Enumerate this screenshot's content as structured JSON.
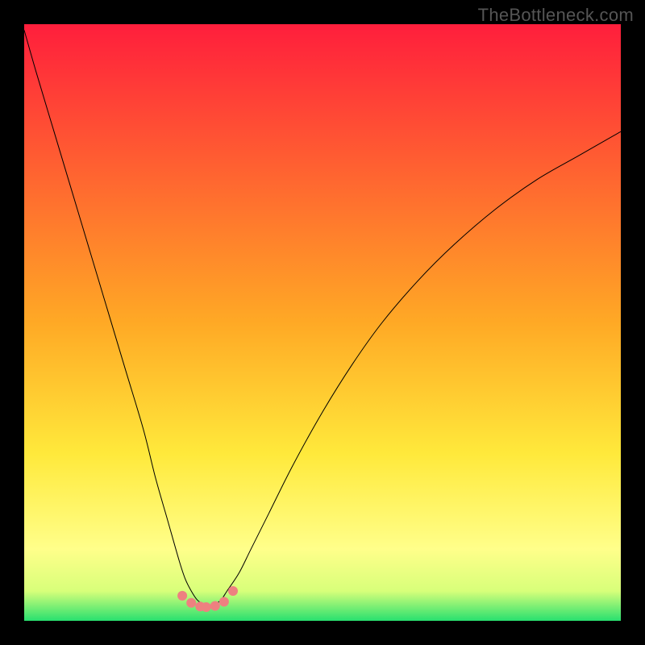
{
  "watermark": "TheBottleneck.com",
  "chart_data": {
    "type": "line",
    "title": "",
    "xlabel": "",
    "ylabel": "",
    "xlim": [
      0,
      100
    ],
    "ylim": [
      0,
      100
    ],
    "axes_visible": false,
    "grid": false,
    "background": {
      "type": "vertical-gradient",
      "stops": [
        {
          "offset": 0,
          "color": "#ff1e3c"
        },
        {
          "offset": 50,
          "color": "#ffa925"
        },
        {
          "offset": 72,
          "color": "#ffe93b"
        },
        {
          "offset": 88,
          "color": "#ffff8a"
        },
        {
          "offset": 95,
          "color": "#d8ff7a"
        },
        {
          "offset": 100,
          "color": "#28e06f"
        }
      ]
    },
    "series": [
      {
        "name": "bottleneck-curve",
        "color": "#000000",
        "stroke_width": 1,
        "x": [
          0,
          2,
          5,
          8,
          11,
          14,
          17,
          20,
          22,
          24,
          26,
          27,
          28,
          29,
          30,
          31,
          32,
          33,
          34,
          36,
          38,
          41,
          45,
          50,
          55,
          60,
          66,
          72,
          79,
          86,
          93,
          100
        ],
        "y": [
          99,
          92,
          82,
          72,
          62,
          52,
          42,
          32,
          24,
          17,
          10,
          7,
          5,
          3.5,
          2.8,
          2.5,
          2.8,
          3.5,
          5,
          8,
          12,
          18,
          26,
          35,
          43,
          50,
          57,
          63,
          69,
          74,
          78,
          82
        ]
      },
      {
        "name": "bottom-markers",
        "type": "scatter",
        "color": "#ee8080",
        "marker_radius": 6,
        "x": [
          26.5,
          28,
          29.5,
          30.5,
          32,
          33.5,
          35
        ],
        "y": [
          4.2,
          3.0,
          2.4,
          2.3,
          2.5,
          3.2,
          5.0
        ]
      }
    ]
  }
}
